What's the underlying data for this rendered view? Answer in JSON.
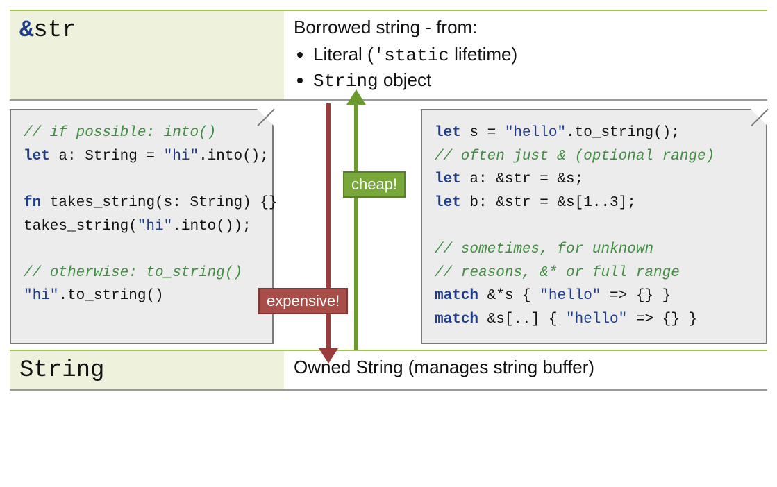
{
  "top": {
    "type_amp": "&",
    "type_name": "str",
    "desc_title": "Borrowed string - from:",
    "bullet1_pre": "Literal (",
    "bullet1_code": "'static",
    "bullet1_post": " lifetime)",
    "bullet2_code": "String",
    "bullet2_post": " object"
  },
  "left_code": {
    "l1": "// if possible: into()",
    "l2a": "let",
    "l2b": " a: String = ",
    "l2c": "\"hi\"",
    "l2d": ".into();",
    "l3a": "fn",
    "l3b": " takes_string(s: String) {}",
    "l4a": "takes_string(",
    "l4b": "\"hi\"",
    "l4c": ".into());",
    "l5": "// otherwise: to_string()",
    "l6a": "\"hi\"",
    "l6b": ".to_string()"
  },
  "right_code": {
    "r1a": "let",
    "r1b": " s = ",
    "r1c": "\"hello\"",
    "r1d": ".to_string();",
    "r2": "// often just & (optional range)",
    "r3a": "let",
    "r3b": " a: &str = &s;",
    "r4a": "let",
    "r4b": " b: &str = &s[1..3];",
    "r5": "// sometimes, for unknown",
    "r6": "// reasons, &* or full range",
    "r7a": "match",
    "r7b": " &*s { ",
    "r7c": "\"hello\"",
    "r7d": " => {} }",
    "r8a": "match",
    "r8b": " &s[..] { ",
    "r8c": "\"hello\"",
    "r8d": " => {} }"
  },
  "tags": {
    "cheap": "cheap!",
    "expensive": "expensive!"
  },
  "bottom": {
    "type_name": "String",
    "desc": "Owned String (manages string buffer)"
  }
}
